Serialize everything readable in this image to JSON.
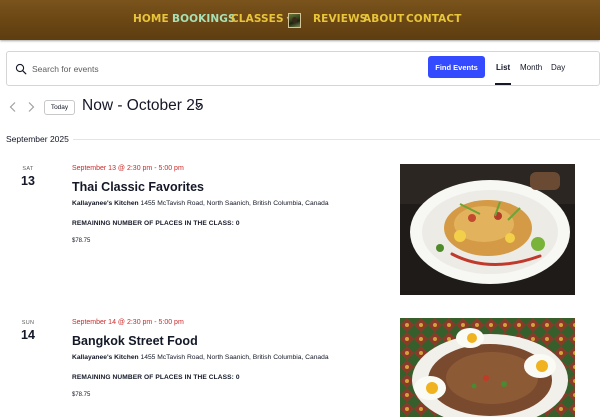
{
  "nav": {
    "items": [
      {
        "label": "HOME"
      },
      {
        "label": "BOOKINGS"
      },
      {
        "label": "CLASSES"
      },
      {
        "label": "REVIEWS"
      },
      {
        "label": "ABOUT"
      },
      {
        "label": "CONTACT"
      }
    ],
    "active_color": "#a7e0b4",
    "item_color": "#e9c53a",
    "bar_color": "#6a4614"
  },
  "search": {
    "placeholder": "Search for events",
    "value": "",
    "button_label": "Find Events",
    "button_color": "#334aff",
    "views": [
      "List",
      "Month",
      "Day"
    ],
    "active_view": "List"
  },
  "datenav": {
    "today_label": "Today",
    "range_label": "Now - October 25"
  },
  "month_label": "September 2025",
  "events": [
    {
      "dow": "SAT",
      "day": "13",
      "when": "September 13 @ 2:30 pm - 5:00 pm",
      "title": "Thai Classic Favorites",
      "venue_name": "Kallayanee's Kitchen",
      "venue_address": "1455 McTavish Road, North Saanich, British Columbia, Canada",
      "remaining": "REMAINING NUMBER OF PLACES IN THE CLASS: 0",
      "price": "$78.75"
    },
    {
      "dow": "SUN",
      "day": "14",
      "when": "September 14 @ 2:30 pm - 5:00 pm",
      "title": "Bangkok Street Food",
      "venue_name": "Kallayanee's Kitchen",
      "venue_address": "1455 McTavish Road, North Saanich, British Columbia, Canada",
      "remaining": "REMAINING NUMBER OF PLACES IN THE CLASS: 0",
      "price": "$78.75"
    }
  ],
  "colors": {
    "date_text": "#c92a2a",
    "text": "#141827"
  }
}
